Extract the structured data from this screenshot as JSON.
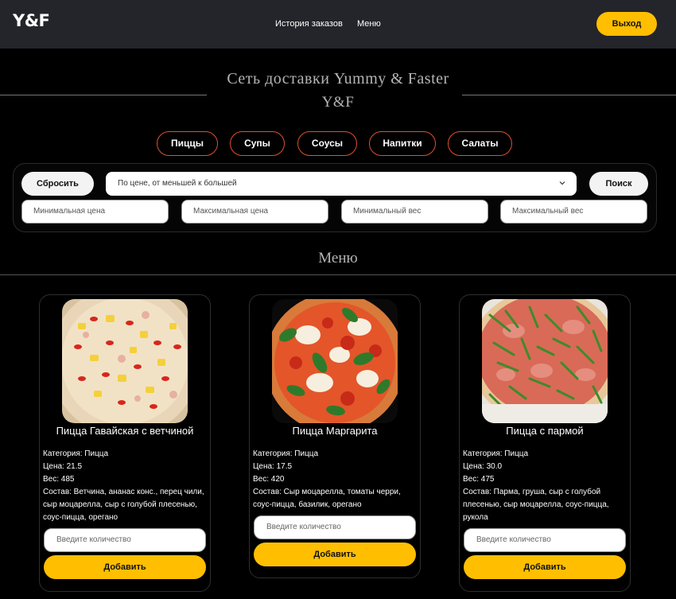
{
  "header": {
    "logo": "Y&F",
    "nav": [
      "История заказов",
      "Меню"
    ],
    "logout_label": "Выход"
  },
  "hero": {
    "title": "Сеть доставки Yummy & Faster",
    "subtitle": "Y&F"
  },
  "categories": [
    "Пиццы",
    "Супы",
    "Соусы",
    "Напитки",
    "Салаты"
  ],
  "filters": {
    "reset_label": "Сбросить",
    "sort_value": "По цене, от меньшей к большей",
    "search_label": "Поиск",
    "min_price_placeholder": "Минимальная цена",
    "max_price_placeholder": "Максимальная цена",
    "min_weight_placeholder": "Минимальный вес",
    "max_weight_placeholder": "Максимальный вес"
  },
  "menu": {
    "title": "Меню",
    "items": [
      {
        "name": "Пицца Гавайская с ветчиной",
        "category": "Категория: Пицца",
        "price": "Цена: 21.5",
        "weight": "Вес: 485",
        "composition": "Состав: Ветчина, ананас конс., перец чили, сыр моцарелла, сыр с голубой плесенью, соус-пицца, орегано",
        "qty_placeholder": "Введите количество",
        "add_label": "Добавить"
      },
      {
        "name": "Пицца Маргарита",
        "category": "Категория: Пицца",
        "price": "Цена: 17.5",
        "weight": "Вес: 420",
        "composition": "Состав: Сыр моцарелла, томаты черри, соус-пицца, базилик, орегано",
        "qty_placeholder": "Введите количество",
        "add_label": "Добавить"
      },
      {
        "name": "Пицца с пармой",
        "category": "Категория: Пицца",
        "price": "Цена: 30.0",
        "weight": "Вес: 475",
        "composition": "Состав: Парма, груша, сыр с голубой плесенью, сыр моцарелла, соус-пицца, рукола",
        "qty_placeholder": "Введите количество",
        "add_label": "Добавить"
      }
    ]
  }
}
